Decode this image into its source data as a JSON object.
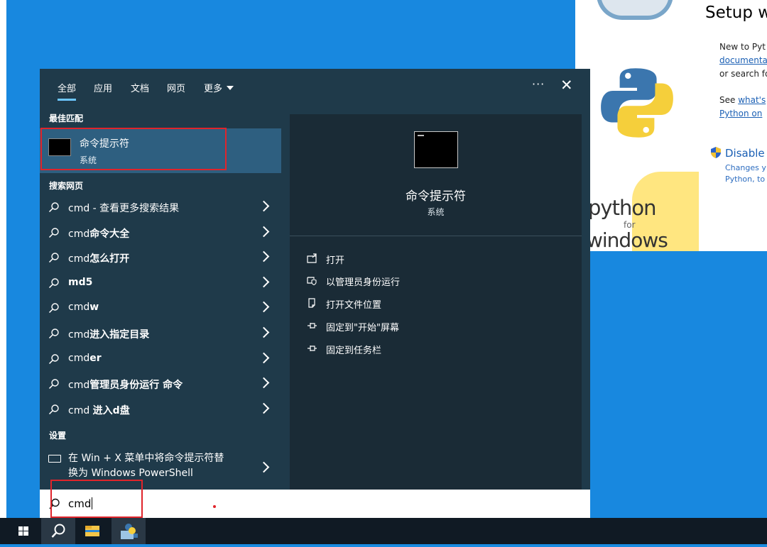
{
  "python_window": {
    "logo_text_1": "python",
    "logo_text_2": "for",
    "logo_text_3": "windows",
    "title": "Setup w",
    "para1_line1": "New to Pyt",
    "para1_line2": "documenta",
    "para1_line3": "or search fo",
    "para2_line1": "See ",
    "para2_link": "what's",
    "para2_line2": "Python on",
    "disable_label": "Disable",
    "disable_sub1": "Changes y",
    "disable_sub2": "Python, to"
  },
  "search_panel": {
    "tabs": [
      {
        "label": "全部",
        "active": true
      },
      {
        "label": "应用"
      },
      {
        "label": "文档"
      },
      {
        "label": "网页"
      },
      {
        "label": "更多"
      }
    ],
    "more_options": "···",
    "close": "✕",
    "best_match_header": "最佳匹配",
    "best_match": {
      "title": "命令提示符",
      "subtitle": "系统"
    },
    "web_header": "搜索网页",
    "web_results": [
      {
        "prefix": "cmd",
        "bold": "",
        "suffix": " - 查看更多搜索结果"
      },
      {
        "prefix": "cmd",
        "bold": "命令大全",
        "suffix": ""
      },
      {
        "prefix": "cmd",
        "bold": "怎么打开",
        "suffix": ""
      },
      {
        "prefix": "",
        "bold": "md5",
        "suffix": ""
      },
      {
        "prefix": "cmd",
        "bold": "w",
        "suffix": ""
      },
      {
        "prefix": "cmd",
        "bold": "进入指定目录",
        "suffix": ""
      },
      {
        "prefix": "cmd",
        "bold": "er",
        "suffix": ""
      },
      {
        "prefix": "cmd",
        "bold": "管理员身份运行 命令",
        "suffix": ""
      },
      {
        "prefix": "cmd ",
        "bold": "进入d盘",
        "suffix": ""
      }
    ],
    "settings_header": "设置",
    "settings_item_line1": "在 Win + X 菜单中将命令提示符替",
    "settings_item_line2": "换为 Windows PowerShell",
    "preview": {
      "title": "命令提示符",
      "subtitle": "系统",
      "actions": [
        "打开",
        "以管理员身份运行",
        "打开文件位置",
        "固定到\"开始\"屏幕",
        "固定到任务栏"
      ]
    },
    "search_query": "cmd"
  },
  "colors": {
    "panel_bg": "#1f3a4a",
    "preview_bg": "#1a2b36",
    "selected_bg": "#2e5f80",
    "highlight_red": "#e0242b",
    "desktop_blue": "#1888df"
  }
}
